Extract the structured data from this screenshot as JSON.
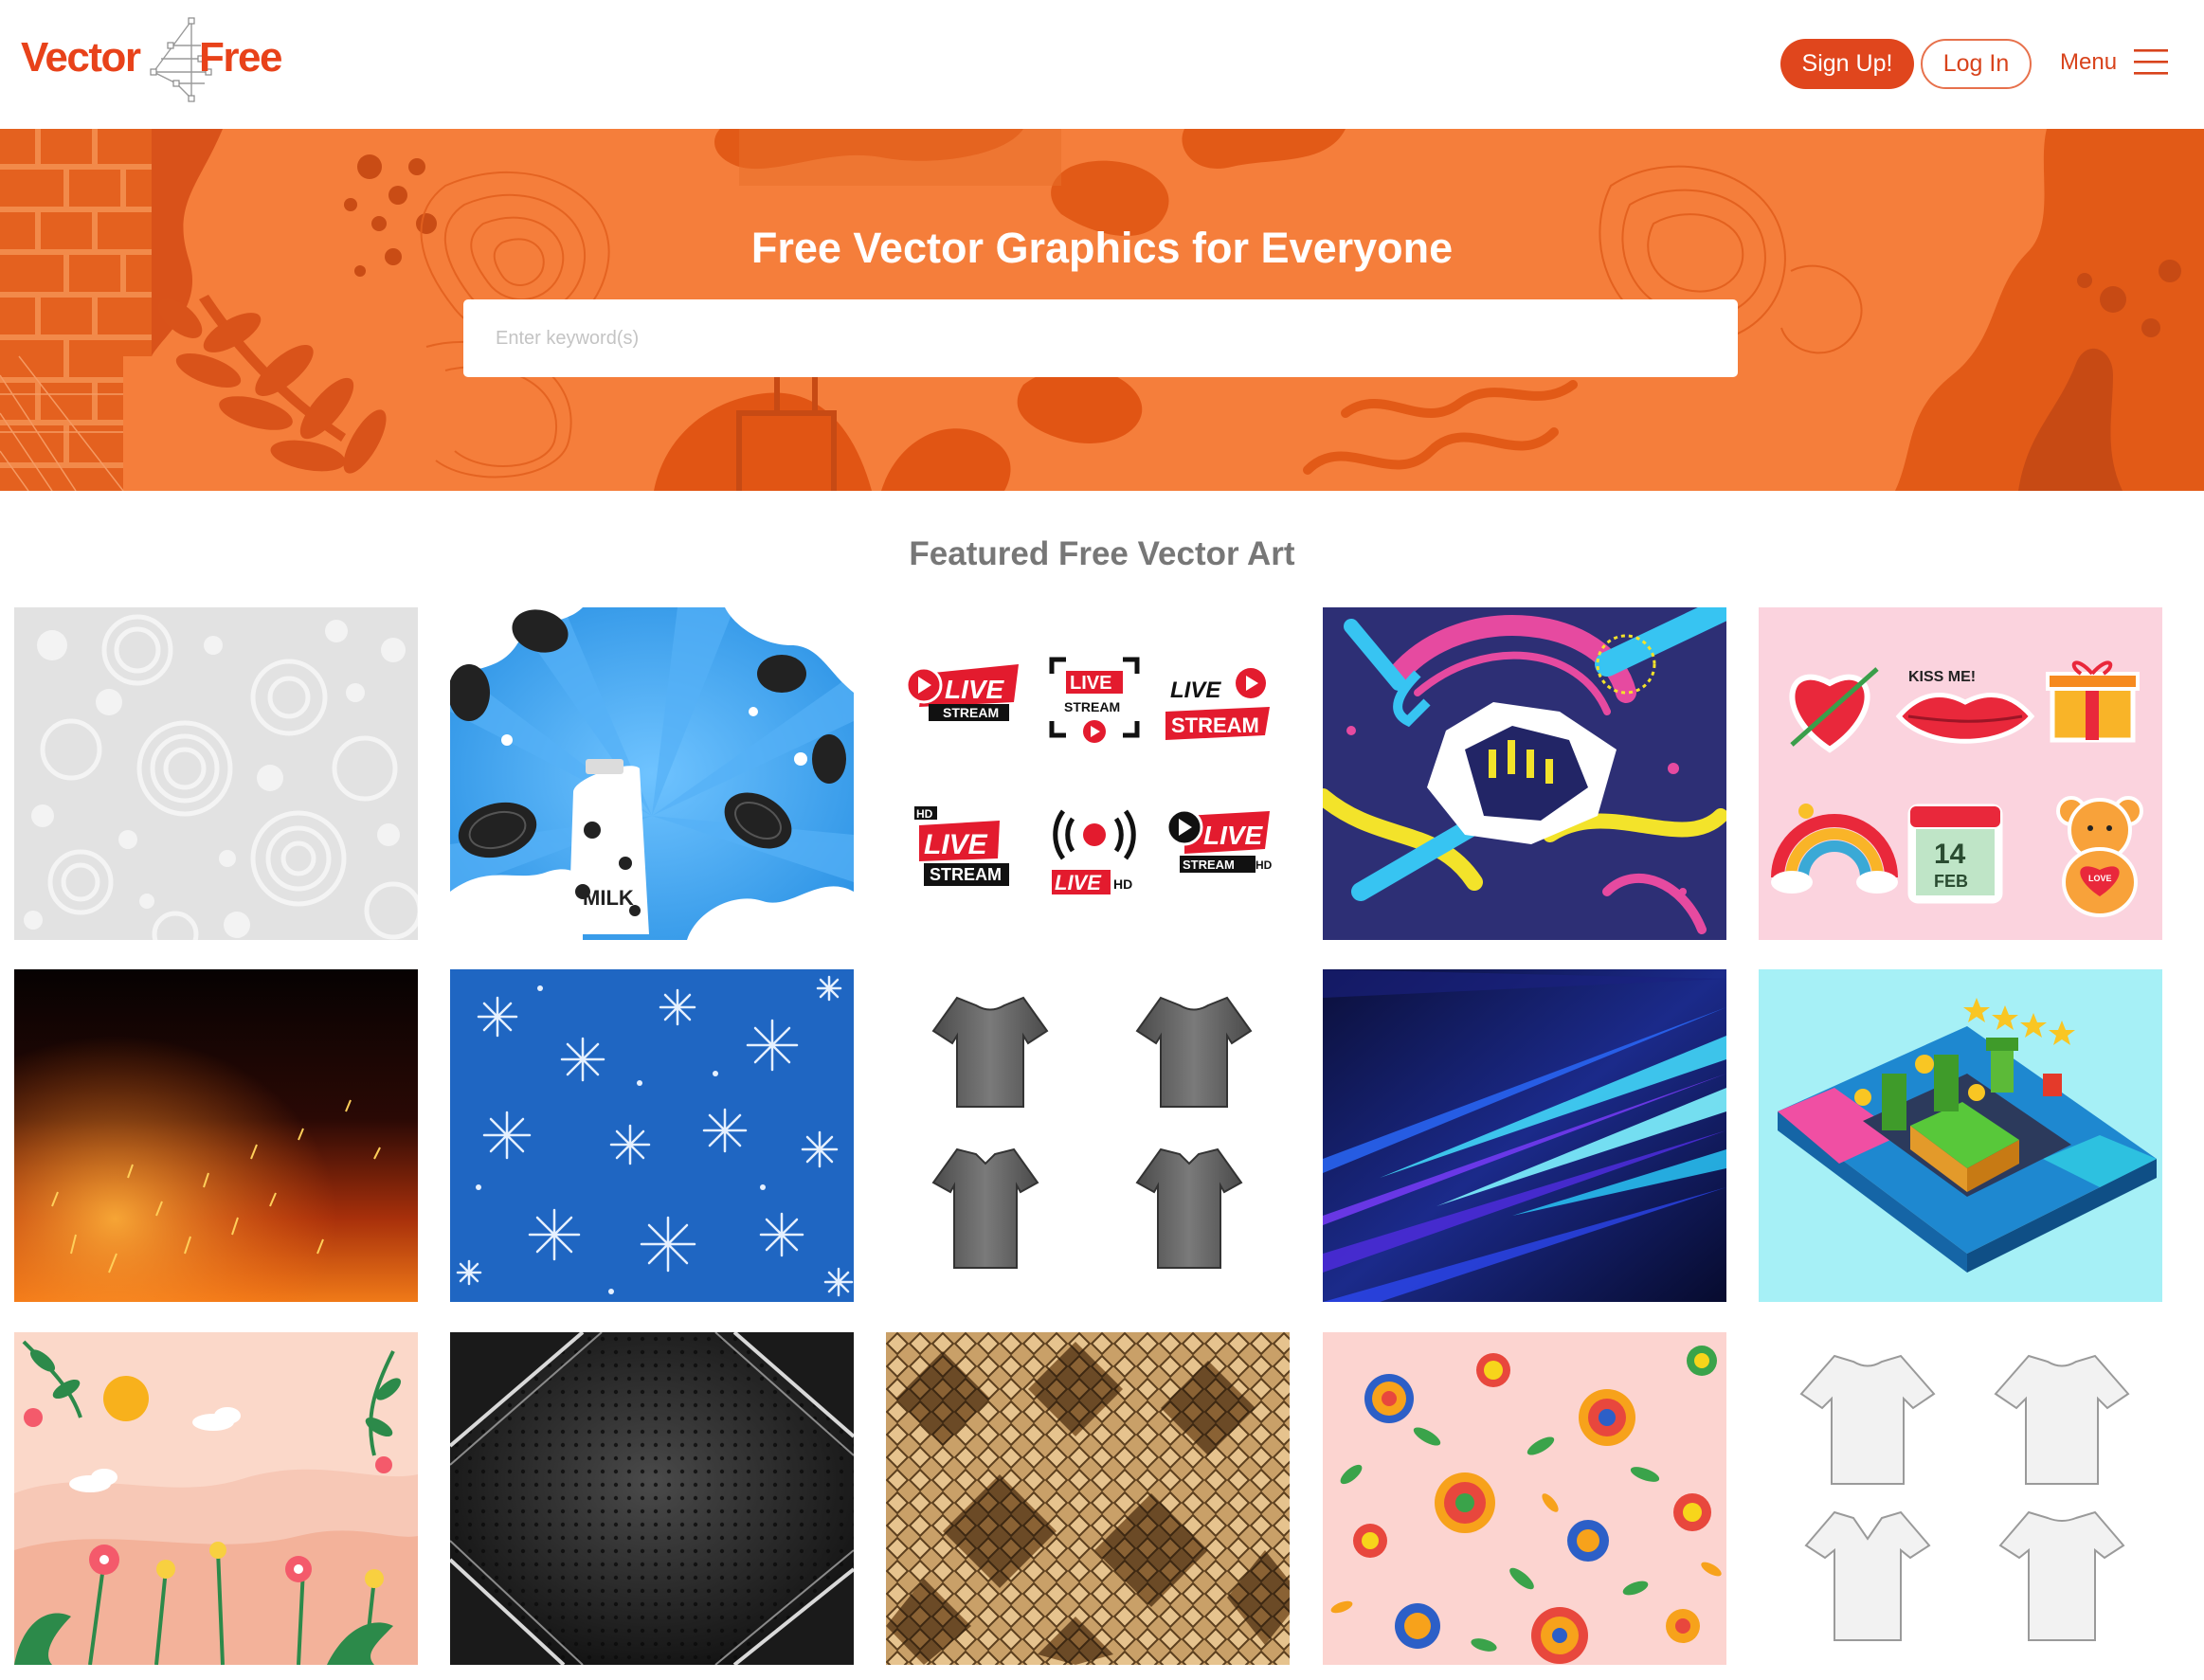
{
  "header": {
    "logo": {
      "left": "Vector",
      "right": "Free",
      "mark": "4"
    },
    "signup_label": "Sign Up!",
    "login_label": "Log In",
    "menu_label": "Menu"
  },
  "hero": {
    "title": "Free Vector Graphics for Everyone",
    "search_placeholder": "Enter keyword(s)"
  },
  "featured": {
    "title": "Featured Free Vector Art"
  },
  "tiles": [
    {
      "name": "white-circles-pattern"
    },
    {
      "name": "milk-cookies",
      "text": "MILK"
    },
    {
      "name": "live-stream-badges",
      "labels": [
        "LIVE",
        "STREAM",
        "HD"
      ]
    },
    {
      "name": "abstract-brush-pattern"
    },
    {
      "name": "valentine-stickers",
      "labels": [
        "KISS ME!",
        "14",
        "FEB",
        "LOVE"
      ]
    },
    {
      "name": "fire-sparks"
    },
    {
      "name": "blue-snowflakes"
    },
    {
      "name": "gray-tshirts"
    },
    {
      "name": "speed-lines"
    },
    {
      "name": "isometric-game-console"
    },
    {
      "name": "spring-flowers-landscape"
    },
    {
      "name": "dark-metal-background"
    },
    {
      "name": "snake-skin-pattern"
    },
    {
      "name": "floral-pattern"
    },
    {
      "name": "white-tshirts"
    }
  ],
  "colors": {
    "brand": "#e0461d",
    "hero_bg": "#f57e3b",
    "hero_dark": "#e25a17",
    "heading_gray": "#777777"
  },
  "icons": [
    "hamburger-menu-icon",
    "logo-mark-icon"
  ]
}
